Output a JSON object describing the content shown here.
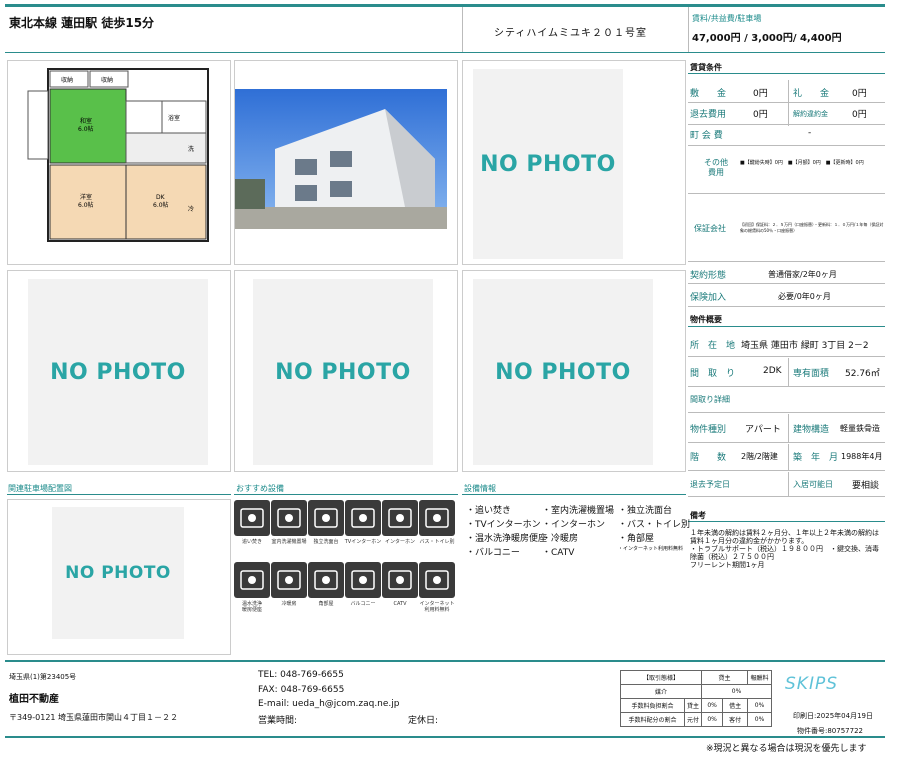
{
  "header": {
    "line_station": "東北本線 蓮田駅 徒歩15分",
    "building_name": "シティハイムミユキ２０１号室",
    "rent_label": "賃料/共益費/駐車場",
    "rent_value": "47,000円 / 3,000円/ 4,400円"
  },
  "photos": {
    "nophoto_text": "NO PHOTO",
    "floorplan_rooms": [
      "収納",
      "収納",
      "和室\n6.0帖",
      "浴室",
      "洗",
      "洋室\n6.0帖",
      "DK\n6.0帖",
      "冷"
    ]
  },
  "conditions": {
    "section_title": "賃貸条件",
    "shikikin_label": "敷　　金",
    "shikikin_value": "0円",
    "reikin_label": "礼　　金",
    "reikin_value": "0円",
    "taikyo_label": "退去費用",
    "taikyo_value": "0円",
    "kaiyaku_label": "解約違約金",
    "kaiyaku_value": "0円",
    "chokai_label": "町 会 費",
    "chokai_value": "-",
    "other_label": "その他\n費用",
    "other_value": "■【鍵紛失時】0円　■【月額】0円　■【更新時】0円",
    "guarantor_label": "保証会社",
    "guarantor_value": "【初回】保証料：２．５万円（口座振替）・更新料：１．０万円/１年毎（保証対象の総賃料の50％・口座振替）",
    "contract_label": "契約形態",
    "contract_value": "普通借家/2年0ヶ月",
    "insurance_label": "保険加入",
    "insurance_value": "必要/0年0ヶ月"
  },
  "overview": {
    "section_title": "物件概要",
    "address_label": "所　在　地",
    "address_value": "埼玉県 蓮田市 緑町 3丁目 2－2",
    "layout_label": "間　取　り",
    "layout_value": "2DK",
    "area_label": "専有面積",
    "area_value": "52.76㎡",
    "layout_detail_label": "間取り詳細",
    "type_label": "物件種別",
    "type_value": "アパート",
    "structure_label": "建物構造",
    "structure_value": "軽量鉄骨造",
    "floor_label": "階　　数",
    "floor_value": "2階/2階建",
    "built_label": "築　年　月",
    "built_value": "1988年4月",
    "moveout_label": "退去予定日",
    "moveout_value": "",
    "movein_label": "入居可能日",
    "movein_value": "要相談"
  },
  "sections": {
    "parking_map": "関連駐車場配置図",
    "recommended": "おすすめ設備",
    "facilities": "設備情報",
    "remarks": "備考"
  },
  "recommended_icons": [
    {
      "name": "reheat-bath-icon",
      "caption": "追い焚き"
    },
    {
      "name": "washer-space-icon",
      "caption": "室内洗濯機置場"
    },
    {
      "name": "vanity-icon",
      "caption": "独立洗面台"
    },
    {
      "name": "tv-intercom-icon",
      "caption": "TVインターホン"
    },
    {
      "name": "intercom-icon",
      "caption": "インターホン"
    },
    {
      "name": "separate-bath-icon",
      "caption": "バス・トイレ別"
    },
    {
      "name": "washlet-icon",
      "caption": "温水洗浄\n暖房便座"
    },
    {
      "name": "aircon-icon",
      "caption": "冷暖房"
    },
    {
      "name": "corner-room-icon",
      "caption": "角部屋"
    },
    {
      "name": "balcony-icon",
      "caption": "バルコニー"
    },
    {
      "name": "catv-icon",
      "caption": "CATV"
    },
    {
      "name": "internet-icon",
      "caption": "インターネット\n利用料無料"
    }
  ],
  "facilities": [
    "・追い焚き",
    "・室内洗濯機置場",
    "・独立洗面台",
    "・TVインターホン",
    "・インターホン",
    "・バス・トイレ別",
    "・温水洗浄暖房便座",
    "・冷暖房",
    "・角部屋",
    "・バルコニー",
    "・CATV",
    "・インターネット利用料無料"
  ],
  "remarks": "１年未満の解約は賃料２ヶ月分、１年以上２年未満の解約は賃料１ヶ月分の違約金がかかります。\n・トラブルサポート（税込）１９８００円　・鍵交換、消毒除菌（税込）２７５００円\nフリーレント期間1ヶ月",
  "footer": {
    "license": "埼玉県(1)第23405号",
    "company": "植田不動産",
    "address": "〒349-0121 埼玉県蓮田市関山４丁目１－２２",
    "tel": "TEL: 048-769-6655",
    "fax": "FAX: 048-769-6655",
    "email": "E-mail:  ueda_h@jcom.zaq.ne.jp",
    "hours_label": "営業時間:",
    "holiday_label": "定休日:",
    "fee_table": {
      "header_left": "【取引態様】",
      "header_right": "貸主",
      "row1_label": "媒介",
      "row1_value": "0%",
      "row2_label": "手数料負担割合",
      "row2_a": "貸主",
      "row2_av": "0%",
      "row2_b": "借主",
      "row2_bv": "0%",
      "row3_label": "手数料配分の割合",
      "row3_a": "元付",
      "row3_av": "0%",
      "row3_b": "客付",
      "row3_bv": "0%",
      "fee_right": "報酬料"
    },
    "brand": "SKIPS",
    "print_date": "印刷日:2025年04月19日",
    "property_no": "物件番号:80757722",
    "disclaimer": "※現況と異なる場合は現況を優先します"
  }
}
